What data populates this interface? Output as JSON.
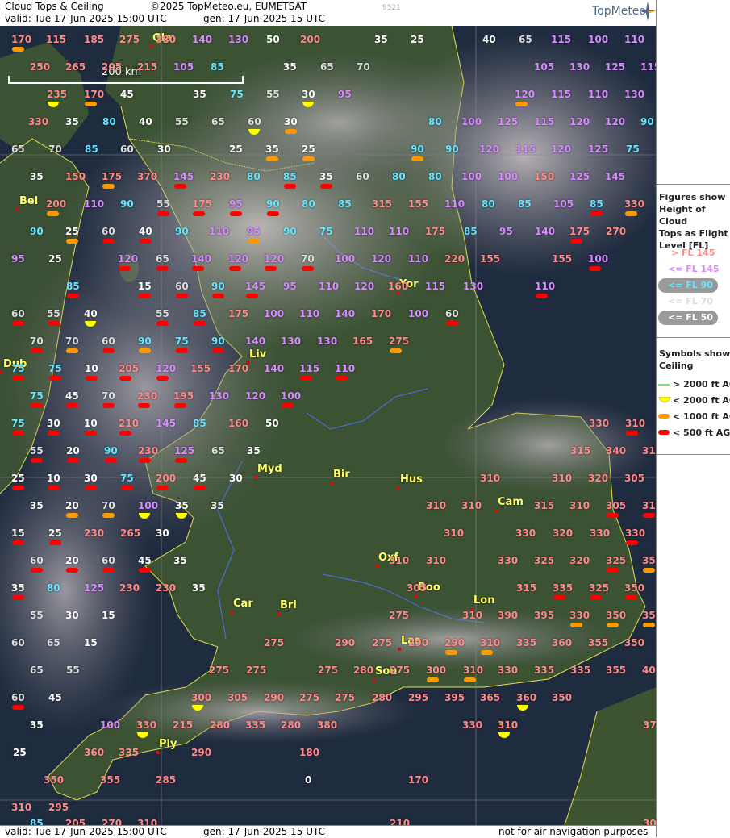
{
  "header": {
    "title": "Cloud Tops & Ceiling",
    "copyright": "©2025 TopMeteo.eu, EUMETSAT",
    "valid": "valid:  Tue  17-Jun-2025  15:00 UTC",
    "gen": "gen: 17-Jun-2025 15 UTC",
    "code": "9521",
    "logo": "TopMeteo"
  },
  "footer": {
    "valid": "valid:  Tue  17-Jun-2025  15:00 UTC",
    "gen": "gen: 17-Jun-2025 15 UTC",
    "disclaimer": "not for air navigation purposes"
  },
  "scale_bar": {
    "label": "200 km"
  },
  "legend": {
    "figures_title": "Figures show Height of Cloud Tops as Flight Level  [FL]",
    "figures_title_lines": [
      "Figures show",
      "Height of Cloud",
      "Tops as Flight",
      "Level  [FL]"
    ],
    "levels": [
      {
        "label": "> FL 145",
        "color": "#ff8a8a"
      },
      {
        "label": "<= FL 145",
        "color": "#d78cff"
      },
      {
        "label": "<= FL 90",
        "color": "#66e6ff"
      },
      {
        "label": "<= FL 70",
        "color": "#dddddd"
      },
      {
        "label": "<= FL 50",
        "color": "#ffffff"
      }
    ],
    "symbols_title_lines": [
      "Symbols show",
      "Ceiling"
    ],
    "symbols": [
      {
        "label": "> 2000 ft AGL",
        "icon": "green-line-icon",
        "color": "#7be27b"
      },
      {
        "label": "< 2000 ft AGL",
        "icon": "yellow-half-disc-icon",
        "color": "#ffff00"
      },
      {
        "label": "< 1000 ft AGL",
        "icon": "orange-bar-icon",
        "color": "#ff9900"
      },
      {
        "label": "< 500 ft AGL",
        "icon": "red-bar-icon",
        "color": "#ff0000"
      }
    ]
  },
  "cities": [
    {
      "name": "Gla"
    },
    {
      "name": "Bel"
    },
    {
      "name": "Yor"
    },
    {
      "name": "Liv"
    },
    {
      "name": "Dub"
    },
    {
      "name": "Myd"
    },
    {
      "name": "Bir"
    },
    {
      "name": "Hus"
    },
    {
      "name": "Cam"
    },
    {
      "name": "Oxf"
    },
    {
      "name": "Boo"
    },
    {
      "name": "Lon"
    },
    {
      "name": "Car"
    },
    {
      "name": "Bri"
    },
    {
      "name": "Las"
    },
    {
      "name": "Sou"
    },
    {
      "name": "Ply"
    }
  ],
  "labels": [
    {
      "v": "170",
      "c": "p"
    },
    {
      "v": "115",
      "c": "p"
    },
    {
      "v": "185",
      "c": "p"
    },
    {
      "v": "275",
      "c": "p"
    },
    {
      "v": "380",
      "c": "p"
    },
    {
      "v": "140",
      "c": "v"
    },
    {
      "v": "130",
      "c": "v"
    },
    {
      "v": "50",
      "c": "w"
    },
    {
      "v": "200",
      "c": "p"
    },
    {
      "v": "35",
      "c": "w"
    },
    {
      "v": "25",
      "c": "w"
    },
    {
      "v": "40",
      "c": "w"
    },
    {
      "v": "65",
      "c": "g"
    },
    {
      "v": "115",
      "c": "v"
    },
    {
      "v": "100",
      "c": "v"
    },
    {
      "v": "110",
      "c": "v"
    },
    {
      "v": "250",
      "c": "p"
    },
    {
      "v": "265",
      "c": "p"
    },
    {
      "v": "205",
      "c": "p"
    },
    {
      "v": "215",
      "c": "p"
    },
    {
      "v": "105",
      "c": "v"
    },
    {
      "v": "85",
      "c": "c"
    },
    {
      "v": "35",
      "c": "w"
    },
    {
      "v": "65",
      "c": "g"
    },
    {
      "v": "70",
      "c": "g"
    },
    {
      "v": "105",
      "c": "v"
    },
    {
      "v": "130",
      "c": "v"
    },
    {
      "v": "125",
      "c": "v"
    },
    {
      "v": "115",
      "c": "v"
    },
    {
      "v": "235",
      "c": "p"
    },
    {
      "v": "170",
      "c": "p"
    },
    {
      "v": "45",
      "c": "w"
    },
    {
      "v": "35",
      "c": "w"
    },
    {
      "v": "75",
      "c": "c"
    },
    {
      "v": "55",
      "c": "g"
    },
    {
      "v": "30",
      "c": "w"
    },
    {
      "v": "95",
      "c": "v"
    },
    {
      "v": "120",
      "c": "v"
    },
    {
      "v": "115",
      "c": "v"
    },
    {
      "v": "110",
      "c": "v"
    },
    {
      "v": "130",
      "c": "v"
    },
    {
      "v": "330",
      "c": "p"
    },
    {
      "v": "35",
      "c": "w"
    },
    {
      "v": "80",
      "c": "c"
    },
    {
      "v": "40",
      "c": "w"
    },
    {
      "v": "55",
      "c": "g"
    },
    {
      "v": "65",
      "c": "g"
    },
    {
      "v": "60",
      "c": "g"
    },
    {
      "v": "30",
      "c": "w"
    },
    {
      "v": "80",
      "c": "c"
    },
    {
      "v": "100",
      "c": "v"
    },
    {
      "v": "125",
      "c": "v"
    },
    {
      "v": "115",
      "c": "v"
    },
    {
      "v": "120",
      "c": "v"
    },
    {
      "v": "120",
      "c": "v"
    },
    {
      "v": "90",
      "c": "c"
    },
    {
      "v": "65",
      "c": "g"
    },
    {
      "v": "70",
      "c": "g"
    },
    {
      "v": "85",
      "c": "c"
    },
    {
      "v": "60",
      "c": "g"
    },
    {
      "v": "30",
      "c": "w"
    },
    {
      "v": "25",
      "c": "w"
    },
    {
      "v": "35",
      "c": "w"
    },
    {
      "v": "25",
      "c": "w"
    },
    {
      "v": "90",
      "c": "c"
    },
    {
      "v": "90",
      "c": "c"
    },
    {
      "v": "120",
      "c": "v"
    },
    {
      "v": "115",
      "c": "v"
    },
    {
      "v": "120",
      "c": "v"
    },
    {
      "v": "125",
      "c": "v"
    },
    {
      "v": "75",
      "c": "c"
    },
    {
      "v": "35",
      "c": "w"
    },
    {
      "v": "150",
      "c": "p"
    },
    {
      "v": "175",
      "c": "p"
    },
    {
      "v": "370",
      "c": "p"
    },
    {
      "v": "145",
      "c": "v"
    },
    {
      "v": "230",
      "c": "p"
    },
    {
      "v": "80",
      "c": "c"
    },
    {
      "v": "85",
      "c": "c"
    },
    {
      "v": "35",
      "c": "w"
    },
    {
      "v": "60",
      "c": "g"
    },
    {
      "v": "80",
      "c": "c"
    },
    {
      "v": "80",
      "c": "c"
    },
    {
      "v": "100",
      "c": "v"
    },
    {
      "v": "100",
      "c": "v"
    },
    {
      "v": "150",
      "c": "p"
    },
    {
      "v": "125",
      "c": "v"
    },
    {
      "v": "145",
      "c": "v"
    },
    {
      "v": "200",
      "c": "p"
    },
    {
      "v": "110",
      "c": "v"
    },
    {
      "v": "90",
      "c": "c"
    },
    {
      "v": "55",
      "c": "g"
    },
    {
      "v": "175",
      "c": "p"
    },
    {
      "v": "95",
      "c": "v"
    },
    {
      "v": "90",
      "c": "c"
    },
    {
      "v": "80",
      "c": "c"
    },
    {
      "v": "85",
      "c": "c"
    },
    {
      "v": "315",
      "c": "p"
    },
    {
      "v": "155",
      "c": "p"
    },
    {
      "v": "110",
      "c": "v"
    },
    {
      "v": "80",
      "c": "c"
    },
    {
      "v": "85",
      "c": "c"
    },
    {
      "v": "105",
      "c": "v"
    },
    {
      "v": "85",
      "c": "c"
    },
    {
      "v": "330",
      "c": "p"
    },
    {
      "v": "90",
      "c": "c"
    },
    {
      "v": "25",
      "c": "w"
    },
    {
      "v": "60",
      "c": "g"
    },
    {
      "v": "40",
      "c": "w"
    },
    {
      "v": "90",
      "c": "c"
    },
    {
      "v": "110",
      "c": "v"
    },
    {
      "v": "95",
      "c": "v"
    },
    {
      "v": "90",
      "c": "c"
    },
    {
      "v": "75",
      "c": "c"
    },
    {
      "v": "110",
      "c": "v"
    },
    {
      "v": "110",
      "c": "v"
    },
    {
      "v": "175",
      "c": "p"
    },
    {
      "v": "85",
      "c": "c"
    },
    {
      "v": "95",
      "c": "v"
    },
    {
      "v": "140",
      "c": "v"
    },
    {
      "v": "175",
      "c": "p"
    },
    {
      "v": "270",
      "c": "p"
    },
    {
      "v": "95",
      "c": "v"
    },
    {
      "v": "25",
      "c": "w"
    },
    {
      "v": "120",
      "c": "v"
    },
    {
      "v": "65",
      "c": "g"
    },
    {
      "v": "140",
      "c": "v"
    },
    {
      "v": "120",
      "c": "v"
    },
    {
      "v": "120",
      "c": "v"
    },
    {
      "v": "70",
      "c": "g"
    },
    {
      "v": "100",
      "c": "v"
    },
    {
      "v": "120",
      "c": "v"
    },
    {
      "v": "110",
      "c": "v"
    },
    {
      "v": "220",
      "c": "p"
    },
    {
      "v": "155",
      "c": "p"
    },
    {
      "v": "155",
      "c": "p"
    },
    {
      "v": "100",
      "c": "v"
    },
    {
      "v": "85",
      "c": "c"
    },
    {
      "v": "15",
      "c": "w"
    },
    {
      "v": "60",
      "c": "g"
    },
    {
      "v": "90",
      "c": "c"
    },
    {
      "v": "145",
      "c": "v"
    },
    {
      "v": "95",
      "c": "v"
    },
    {
      "v": "110",
      "c": "v"
    },
    {
      "v": "120",
      "c": "v"
    },
    {
      "v": "160",
      "c": "p"
    },
    {
      "v": "115",
      "c": "v"
    },
    {
      "v": "130",
      "c": "v"
    },
    {
      "v": "110",
      "c": "v"
    },
    {
      "v": "60",
      "c": "g"
    },
    {
      "v": "55",
      "c": "g"
    },
    {
      "v": "40",
      "c": "w"
    },
    {
      "v": "55",
      "c": "g"
    },
    {
      "v": "85",
      "c": "c"
    },
    {
      "v": "175",
      "c": "p"
    },
    {
      "v": "100",
      "c": "v"
    },
    {
      "v": "110",
      "c": "v"
    },
    {
      "v": "140",
      "c": "v"
    },
    {
      "v": "170",
      "c": "p"
    },
    {
      "v": "100",
      "c": "v"
    },
    {
      "v": "60",
      "c": "g"
    },
    {
      "v": "70",
      "c": "g"
    },
    {
      "v": "70",
      "c": "g"
    },
    {
      "v": "60",
      "c": "g"
    },
    {
      "v": "90",
      "c": "c"
    },
    {
      "v": "75",
      "c": "c"
    },
    {
      "v": "90",
      "c": "c"
    },
    {
      "v": "140",
      "c": "v"
    },
    {
      "v": "130",
      "c": "v"
    },
    {
      "v": "130",
      "c": "v"
    },
    {
      "v": "165",
      "c": "p"
    },
    {
      "v": "275",
      "c": "p"
    },
    {
      "v": "75",
      "c": "c"
    },
    {
      "v": "75",
      "c": "c"
    },
    {
      "v": "10",
      "c": "w"
    },
    {
      "v": "205",
      "c": "p"
    },
    {
      "v": "120",
      "c": "v"
    },
    {
      "v": "155",
      "c": "p"
    },
    {
      "v": "170",
      "c": "p"
    },
    {
      "v": "140",
      "c": "v"
    },
    {
      "v": "115",
      "c": "v"
    },
    {
      "v": "110",
      "c": "v"
    },
    {
      "v": "75",
      "c": "c"
    },
    {
      "v": "45",
      "c": "w"
    },
    {
      "v": "70",
      "c": "g"
    },
    {
      "v": "230",
      "c": "p"
    },
    {
      "v": "195",
      "c": "p"
    },
    {
      "v": "130",
      "c": "v"
    },
    {
      "v": "120",
      "c": "v"
    },
    {
      "v": "100",
      "c": "v"
    },
    {
      "v": "75",
      "c": "c"
    },
    {
      "v": "30",
      "c": "w"
    },
    {
      "v": "10",
      "c": "w"
    },
    {
      "v": "210",
      "c": "p"
    },
    {
      "v": "145",
      "c": "v"
    },
    {
      "v": "85",
      "c": "c"
    },
    {
      "v": "160",
      "c": "p"
    },
    {
      "v": "50",
      "c": "w"
    },
    {
      "v": "330",
      "c": "p"
    },
    {
      "v": "310",
      "c": "p"
    },
    {
      "v": "55",
      "c": "g"
    },
    {
      "v": "20",
      "c": "w"
    },
    {
      "v": "90",
      "c": "c"
    },
    {
      "v": "230",
      "c": "p"
    },
    {
      "v": "125",
      "c": "v"
    },
    {
      "v": "65",
      "c": "g"
    },
    {
      "v": "35",
      "c": "w"
    },
    {
      "v": "315",
      "c": "p"
    },
    {
      "v": "340",
      "c": "p"
    },
    {
      "v": "315",
      "c": "p"
    },
    {
      "v": "25",
      "c": "w"
    },
    {
      "v": "10",
      "c": "w"
    },
    {
      "v": "30",
      "c": "w"
    },
    {
      "v": "75",
      "c": "c"
    },
    {
      "v": "200",
      "c": "p"
    },
    {
      "v": "45",
      "c": "w"
    },
    {
      "v": "30",
      "c": "w"
    },
    {
      "v": "310",
      "c": "p"
    },
    {
      "v": "310",
      "c": "p"
    },
    {
      "v": "320",
      "c": "p"
    },
    {
      "v": "305",
      "c": "p"
    },
    {
      "v": "35",
      "c": "w"
    },
    {
      "v": "20",
      "c": "w"
    },
    {
      "v": "70",
      "c": "g"
    },
    {
      "v": "100",
      "c": "v"
    },
    {
      "v": "35",
      "c": "w"
    },
    {
      "v": "35",
      "c": "w"
    },
    {
      "v": "310",
      "c": "p"
    },
    {
      "v": "310",
      "c": "p"
    },
    {
      "v": "315",
      "c": "p"
    },
    {
      "v": "310",
      "c": "p"
    },
    {
      "v": "305",
      "c": "p"
    },
    {
      "v": "315",
      "c": "p"
    },
    {
      "v": "15",
      "c": "w"
    },
    {
      "v": "25",
      "c": "w"
    },
    {
      "v": "230",
      "c": "p"
    },
    {
      "v": "265",
      "c": "p"
    },
    {
      "v": "30",
      "c": "w"
    },
    {
      "v": "310",
      "c": "p"
    },
    {
      "v": "330",
      "c": "p"
    },
    {
      "v": "320",
      "c": "p"
    },
    {
      "v": "330",
      "c": "p"
    },
    {
      "v": "330",
      "c": "p"
    },
    {
      "v": "60",
      "c": "g"
    },
    {
      "v": "20",
      "c": "w"
    },
    {
      "v": "60",
      "c": "g"
    },
    {
      "v": "45",
      "c": "w"
    },
    {
      "v": "35",
      "c": "w"
    },
    {
      "v": "310",
      "c": "p"
    },
    {
      "v": "310",
      "c": "p"
    },
    {
      "v": "330",
      "c": "p"
    },
    {
      "v": "325",
      "c": "p"
    },
    {
      "v": "320",
      "c": "p"
    },
    {
      "v": "325",
      "c": "p"
    },
    {
      "v": "350",
      "c": "p"
    },
    {
      "v": "35",
      "c": "w"
    },
    {
      "v": "80",
      "c": "c"
    },
    {
      "v": "125",
      "c": "v"
    },
    {
      "v": "230",
      "c": "p"
    },
    {
      "v": "230",
      "c": "p"
    },
    {
      "v": "35",
      "c": "w"
    },
    {
      "v": "305",
      "c": "p"
    },
    {
      "v": "315",
      "c": "p"
    },
    {
      "v": "335",
      "c": "p"
    },
    {
      "v": "325",
      "c": "p"
    },
    {
      "v": "350",
      "c": "p"
    },
    {
      "v": "55",
      "c": "g"
    },
    {
      "v": "30",
      "c": "w"
    },
    {
      "v": "15",
      "c": "w"
    },
    {
      "v": "275",
      "c": "p"
    },
    {
      "v": "310",
      "c": "p"
    },
    {
      "v": "390",
      "c": "p"
    },
    {
      "v": "395",
      "c": "p"
    },
    {
      "v": "330",
      "c": "p"
    },
    {
      "v": "350",
      "c": "p"
    },
    {
      "v": "350",
      "c": "p"
    },
    {
      "v": "60",
      "c": "g"
    },
    {
      "v": "65",
      "c": "g"
    },
    {
      "v": "15",
      "c": "w"
    },
    {
      "v": "275",
      "c": "p"
    },
    {
      "v": "290",
      "c": "p"
    },
    {
      "v": "275",
      "c": "p"
    },
    {
      "v": "290",
      "c": "p"
    },
    {
      "v": "290",
      "c": "p"
    },
    {
      "v": "310",
      "c": "p"
    },
    {
      "v": "335",
      "c": "p"
    },
    {
      "v": "360",
      "c": "p"
    },
    {
      "v": "355",
      "c": "p"
    },
    {
      "v": "350",
      "c": "p"
    },
    {
      "v": "65",
      "c": "g"
    },
    {
      "v": "55",
      "c": "g"
    },
    {
      "v": "275",
      "c": "p"
    },
    {
      "v": "275",
      "c": "p"
    },
    {
      "v": "275",
      "c": "p"
    },
    {
      "v": "280",
      "c": "p"
    },
    {
      "v": "275",
      "c": "p"
    },
    {
      "v": "300",
      "c": "p"
    },
    {
      "v": "310",
      "c": "p"
    },
    {
      "v": "330",
      "c": "p"
    },
    {
      "v": "335",
      "c": "p"
    },
    {
      "v": "335",
      "c": "p"
    },
    {
      "v": "355",
      "c": "p"
    },
    {
      "v": "400",
      "c": "p"
    },
    {
      "v": "60",
      "c": "g"
    },
    {
      "v": "45",
      "c": "w"
    },
    {
      "v": "300",
      "c": "p"
    },
    {
      "v": "305",
      "c": "p"
    },
    {
      "v": "290",
      "c": "p"
    },
    {
      "v": "275",
      "c": "p"
    },
    {
      "v": "275",
      "c": "p"
    },
    {
      "v": "280",
      "c": "p"
    },
    {
      "v": "295",
      "c": "p"
    },
    {
      "v": "395",
      "c": "p"
    },
    {
      "v": "365",
      "c": "p"
    },
    {
      "v": "360",
      "c": "p"
    },
    {
      "v": "350",
      "c": "p"
    },
    {
      "v": "35",
      "c": "w"
    },
    {
      "v": "100",
      "c": "v"
    },
    {
      "v": "330",
      "c": "p"
    },
    {
      "v": "215",
      "c": "p"
    },
    {
      "v": "280",
      "c": "p"
    },
    {
      "v": "335",
      "c": "p"
    },
    {
      "v": "280",
      "c": "p"
    },
    {
      "v": "380",
      "c": "p"
    },
    {
      "v": "330",
      "c": "p"
    },
    {
      "v": "310",
      "c": "p"
    },
    {
      "v": "375",
      "c": "p"
    },
    {
      "v": "25",
      "c": "w"
    },
    {
      "v": "360",
      "c": "p"
    },
    {
      "v": "335",
      "c": "p"
    },
    {
      "v": "290",
      "c": "p"
    },
    {
      "v": "180",
      "c": "p"
    },
    {
      "v": "350",
      "c": "p"
    },
    {
      "v": "355",
      "c": "p"
    },
    {
      "v": "285",
      "c": "p"
    },
    {
      "v": "0",
      "c": "w"
    },
    {
      "v": "170",
      "c": "p"
    },
    {
      "v": "310",
      "c": "p"
    },
    {
      "v": "295",
      "c": "p"
    },
    {
      "v": "85",
      "c": "c"
    },
    {
      "v": "205",
      "c": "p"
    },
    {
      "v": "270",
      "c": "p"
    },
    {
      "v": "310",
      "c": "p"
    },
    {
      "v": "210",
      "c": "p"
    },
    {
      "v": "300",
      "c": "p"
    }
  ]
}
